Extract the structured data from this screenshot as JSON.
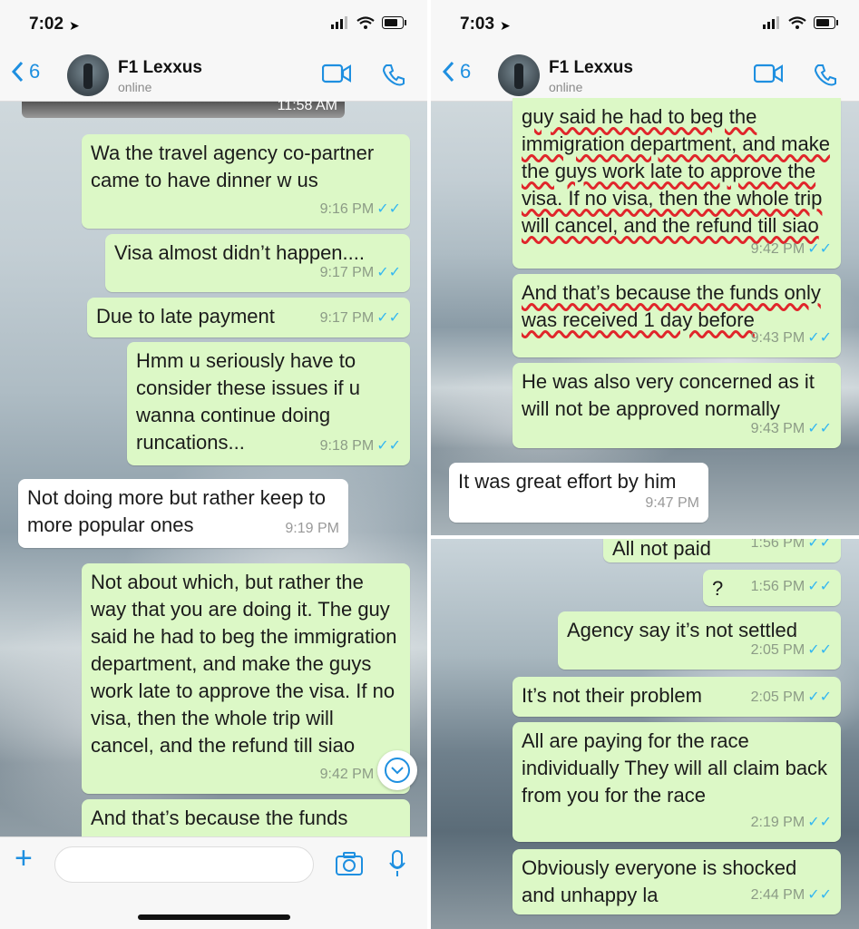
{
  "left": {
    "status_time": "7:02",
    "back_count": "6",
    "contact_name": "F1 Lexxus",
    "contact_status": "online",
    "photo_time": "11:58 AM",
    "messages": [
      {
        "text": "Wa the travel agency co-partner came to have dinner w us",
        "time": "9:16 PM"
      },
      {
        "text": "Visa almost didn’t happen....",
        "time": "9:17 PM"
      },
      {
        "text": "Due to late payment",
        "time": "9:17 PM"
      },
      {
        "text": "Hmm u seriously have to consider these issues if u wanna continue doing runcations...",
        "time": "9:18 PM"
      },
      {
        "text": "Not doing more but rather keep to more popular ones",
        "time": "9:19 PM"
      },
      {
        "text": "Not about which, but rather the way that you are doing it. The guy said he had to beg the immigration department, and make the guys work late to approve the visa. If no visa, then the whole trip will cancel, and the refund till siao",
        "time": "9:42 PM"
      },
      {
        "text": "And that’s because the funds"
      }
    ]
  },
  "right_top": {
    "status_time": "7:03",
    "back_count": "6",
    "contact_name": "F1 Lexxus",
    "contact_status": "online",
    "messages": [
      {
        "text": "guy said he had to beg the immigration department, and make the guys work late to approve the visa. If no visa, then the whole trip will cancel, and the refund till siao",
        "time": "9:42 PM"
      },
      {
        "text": "And that’s because the funds only was received 1 day before",
        "time": "9:43 PM"
      },
      {
        "text": "He was also very concerned as it will not be approved normally",
        "time": "9:43 PM"
      },
      {
        "text": "It was great effort by him",
        "time": "9:47 PM"
      }
    ]
  },
  "right_bottom": {
    "messages": [
      {
        "text": "All not paid",
        "time": "1:56 PM"
      },
      {
        "text": "?",
        "time": "1:56 PM"
      },
      {
        "text": "Agency say it’s not settled",
        "time": "2:05 PM"
      },
      {
        "text": "It’s not their problem",
        "time": "2:05 PM"
      },
      {
        "text": "All are paying for the race individually They will all claim back from you for the race",
        "time": "2:19 PM"
      },
      {
        "text": "Obviously everyone is shocked and unhappy la",
        "time": "2:44 PM"
      }
    ]
  },
  "colors": {
    "outgoing": "#dcf8c6",
    "incoming": "#ffffff",
    "accent": "#1e8fe0",
    "tick": "#34b7f1",
    "strike": "#e0262b"
  }
}
